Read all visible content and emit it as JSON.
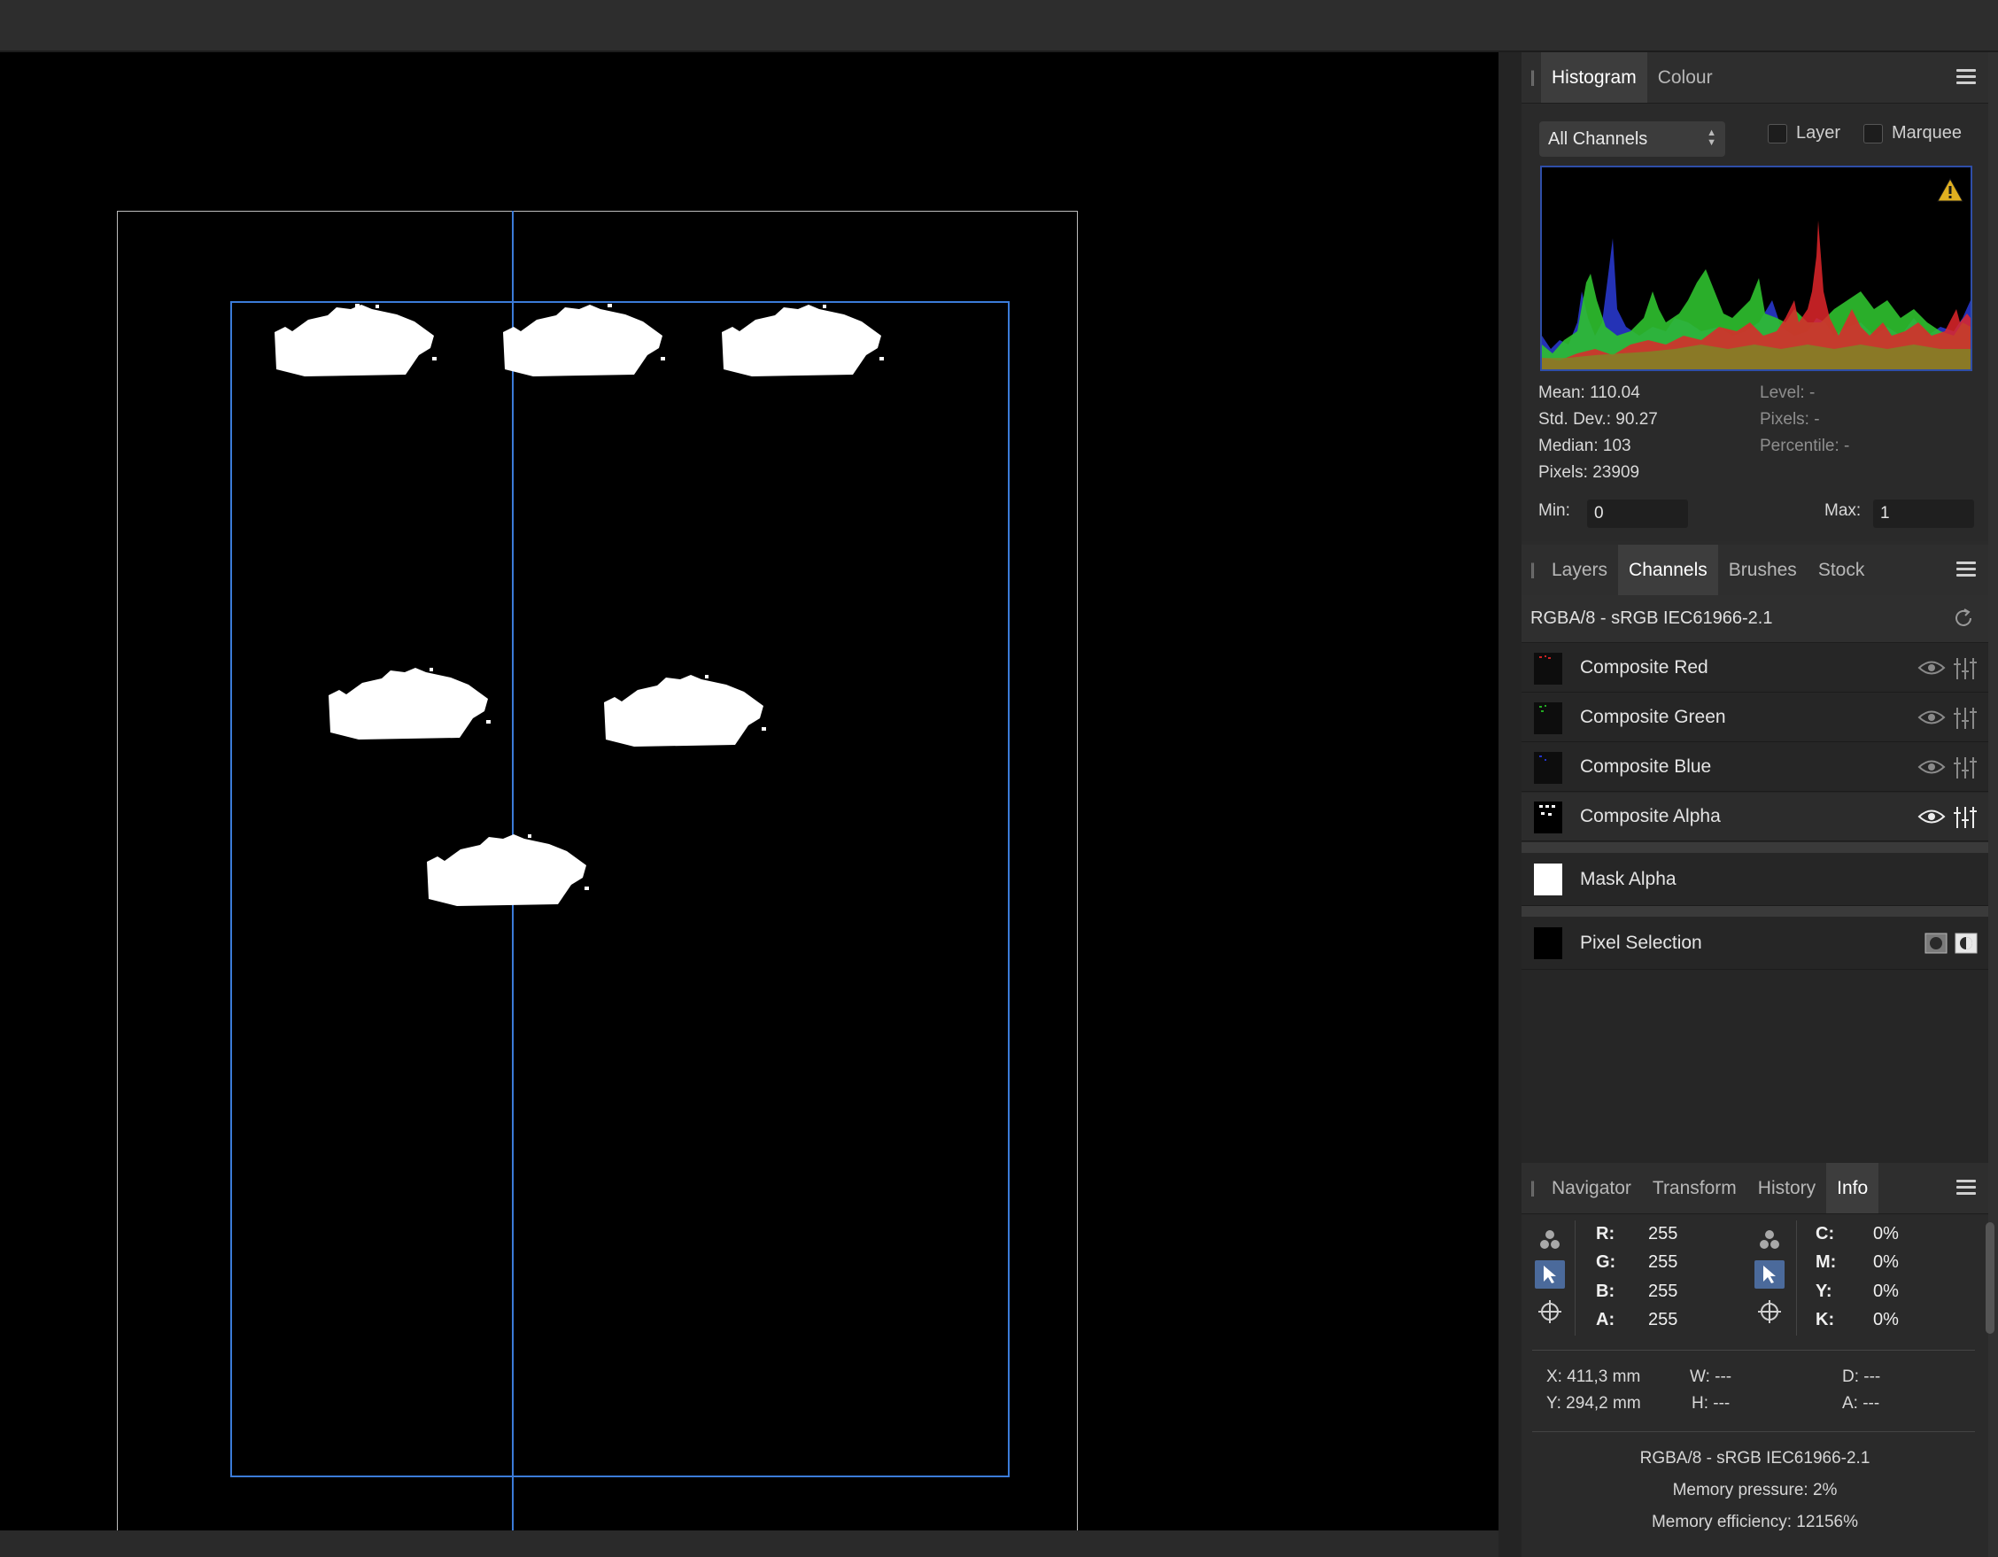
{
  "histogram_panel": {
    "tabs": [
      "Histogram",
      "Colour"
    ],
    "channel_select": "All Channels",
    "layer_checkbox": "Layer",
    "marquee_checkbox": "Marquee",
    "mean": "Mean: 110.04",
    "std_dev": "Std. Dev.: 90.27",
    "median": "Median: 103",
    "pixels": "Pixels: 23909",
    "level": "Level: -",
    "pixels_cursor": "Pixels: -",
    "percentile": "Percentile: -",
    "min_label": "Min:",
    "min_value": "0",
    "max_label": "Max:",
    "max_value": "1"
  },
  "channels_panel": {
    "tabs": [
      "Layers",
      "Channels",
      "Brushes",
      "Stock"
    ],
    "profile": "RGBA/8 - sRGB IEC61966-2.1",
    "channels": [
      {
        "label": "Composite Red"
      },
      {
        "label": "Composite Green"
      },
      {
        "label": "Composite Blue"
      },
      {
        "label": "Composite Alpha"
      }
    ],
    "mask_alpha": "Mask Alpha",
    "pixel_selection": "Pixel Selection"
  },
  "info_panel": {
    "tabs": [
      "Navigator",
      "Transform",
      "History",
      "Info"
    ],
    "rgb": [
      {
        "label": "R:",
        "value": "255"
      },
      {
        "label": "G:",
        "value": "255"
      },
      {
        "label": "B:",
        "value": "255"
      },
      {
        "label": "A:",
        "value": "255"
      }
    ],
    "cmyk": [
      {
        "label": "C:",
        "value": "0%"
      },
      {
        "label": "M:",
        "value": "0%"
      },
      {
        "label": "Y:",
        "value": "0%"
      },
      {
        "label": "K:",
        "value": "0%"
      }
    ],
    "x": "X: 411,3 mm",
    "y": "Y: 294,2 mm",
    "w": "W: ---",
    "h": "H: ---",
    "d": "D: ---",
    "a": "A: ---",
    "profile": "RGBA/8 - sRGB IEC61966-2.1",
    "memory_pressure": "Memory pressure: 2%",
    "memory_efficiency": "Memory efficiency: 12156%"
  },
  "colors": {
    "accent_guide": "#3b7bd8",
    "histogram_red": "#e0262a",
    "histogram_green": "#2fc12f",
    "histogram_blue": "#2a3bd6"
  }
}
